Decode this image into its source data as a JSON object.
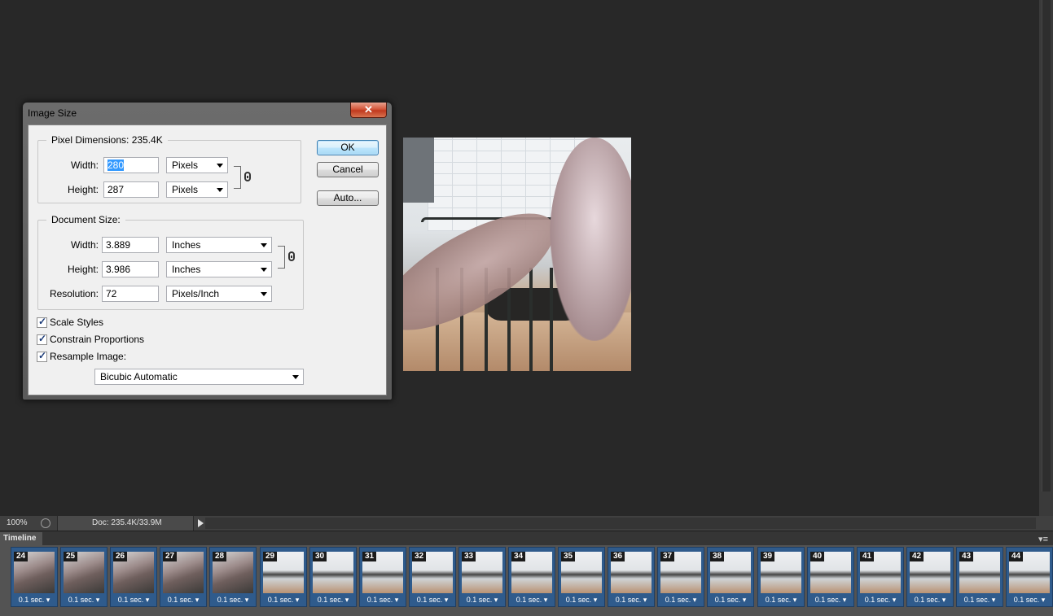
{
  "dialog": {
    "title": "Image Size",
    "close_glyph": "✕",
    "pixel_dimensions": {
      "title": "Pixel Dimensions:  235.4K",
      "width_label": "Width:",
      "width_value": "280",
      "width_unit": "Pixels",
      "height_label": "Height:",
      "height_value": "287",
      "height_unit": "Pixels"
    },
    "document_size": {
      "title": "Document Size:",
      "width_label": "Width:",
      "width_value": "3.889",
      "width_unit": "Inches",
      "height_label": "Height:",
      "height_value": "3.986",
      "height_unit": "Inches",
      "resolution_label": "Resolution:",
      "resolution_value": "72",
      "resolution_unit": "Pixels/Inch"
    },
    "options": {
      "scale_styles": "Scale Styles",
      "constrain_proportions": "Constrain Proportions",
      "resample_image": "Resample Image:",
      "resample_method": "Bicubic Automatic"
    },
    "buttons": {
      "ok": "OK",
      "cancel": "Cancel",
      "auto": "Auto..."
    }
  },
  "status": {
    "zoom": "100%",
    "doc": "Doc: 235.4K/33.9M"
  },
  "timeline": {
    "tab_label": "Timeline",
    "menu_icon": "panel-menu-icon",
    "frames": [
      {
        "num": "24",
        "delay": "0.1 sec."
      },
      {
        "num": "25",
        "delay": "0.1 sec."
      },
      {
        "num": "26",
        "delay": "0.1 sec."
      },
      {
        "num": "27",
        "delay": "0.1 sec."
      },
      {
        "num": "28",
        "delay": "0.1 sec."
      },
      {
        "num": "29",
        "delay": "0.1 sec."
      },
      {
        "num": "30",
        "delay": "0.1 sec."
      },
      {
        "num": "31",
        "delay": "0.1 sec."
      },
      {
        "num": "32",
        "delay": "0.1 sec."
      },
      {
        "num": "33",
        "delay": "0.1 sec."
      },
      {
        "num": "34",
        "delay": "0.1 sec."
      },
      {
        "num": "35",
        "delay": "0.1 sec."
      },
      {
        "num": "36",
        "delay": "0.1 sec."
      },
      {
        "num": "37",
        "delay": "0.1 sec."
      },
      {
        "num": "38",
        "delay": "0.1 sec."
      },
      {
        "num": "39",
        "delay": "0.1 sec."
      },
      {
        "num": "40",
        "delay": "0.1 sec."
      },
      {
        "num": "41",
        "delay": "0.1 sec."
      },
      {
        "num": "42",
        "delay": "0.1 sec."
      },
      {
        "num": "43",
        "delay": "0.1 sec."
      },
      {
        "num": "44",
        "delay": "0.1 sec."
      }
    ]
  },
  "colors": {
    "workspace": "#282828",
    "frame_bg": "#2f5b8c",
    "selection": "#3399ff",
    "close_button": "#c0391e"
  }
}
